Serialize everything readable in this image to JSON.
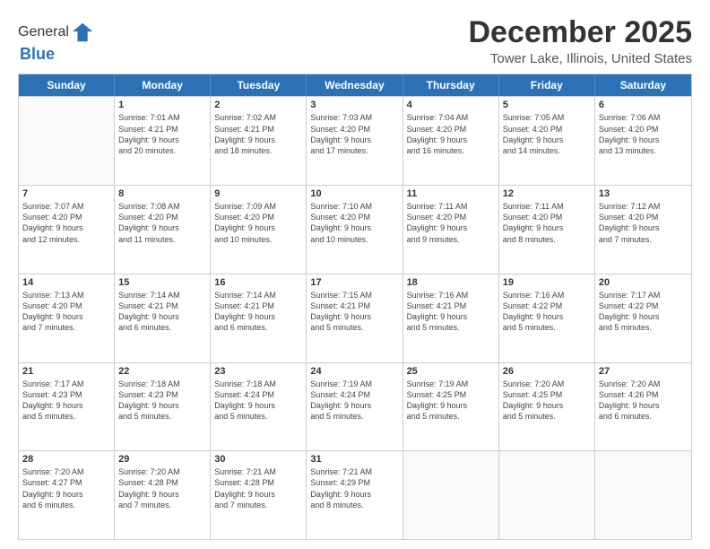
{
  "header": {
    "logo_line1": "General",
    "logo_line2": "Blue",
    "title": "December 2025",
    "subtitle": "Tower Lake, Illinois, United States"
  },
  "weekdays": [
    "Sunday",
    "Monday",
    "Tuesday",
    "Wednesday",
    "Thursday",
    "Friday",
    "Saturday"
  ],
  "weeks": [
    [
      {
        "day": "",
        "lines": []
      },
      {
        "day": "1",
        "lines": [
          "Sunrise: 7:01 AM",
          "Sunset: 4:21 PM",
          "Daylight: 9 hours",
          "and 20 minutes."
        ]
      },
      {
        "day": "2",
        "lines": [
          "Sunrise: 7:02 AM",
          "Sunset: 4:21 PM",
          "Daylight: 9 hours",
          "and 18 minutes."
        ]
      },
      {
        "day": "3",
        "lines": [
          "Sunrise: 7:03 AM",
          "Sunset: 4:20 PM",
          "Daylight: 9 hours",
          "and 17 minutes."
        ]
      },
      {
        "day": "4",
        "lines": [
          "Sunrise: 7:04 AM",
          "Sunset: 4:20 PM",
          "Daylight: 9 hours",
          "and 16 minutes."
        ]
      },
      {
        "day": "5",
        "lines": [
          "Sunrise: 7:05 AM",
          "Sunset: 4:20 PM",
          "Daylight: 9 hours",
          "and 14 minutes."
        ]
      },
      {
        "day": "6",
        "lines": [
          "Sunrise: 7:06 AM",
          "Sunset: 4:20 PM",
          "Daylight: 9 hours",
          "and 13 minutes."
        ]
      }
    ],
    [
      {
        "day": "7",
        "lines": [
          "Sunrise: 7:07 AM",
          "Sunset: 4:20 PM",
          "Daylight: 9 hours",
          "and 12 minutes."
        ]
      },
      {
        "day": "8",
        "lines": [
          "Sunrise: 7:08 AM",
          "Sunset: 4:20 PM",
          "Daylight: 9 hours",
          "and 11 minutes."
        ]
      },
      {
        "day": "9",
        "lines": [
          "Sunrise: 7:09 AM",
          "Sunset: 4:20 PM",
          "Daylight: 9 hours",
          "and 10 minutes."
        ]
      },
      {
        "day": "10",
        "lines": [
          "Sunrise: 7:10 AM",
          "Sunset: 4:20 PM",
          "Daylight: 9 hours",
          "and 10 minutes."
        ]
      },
      {
        "day": "11",
        "lines": [
          "Sunrise: 7:11 AM",
          "Sunset: 4:20 PM",
          "Daylight: 9 hours",
          "and 9 minutes."
        ]
      },
      {
        "day": "12",
        "lines": [
          "Sunrise: 7:11 AM",
          "Sunset: 4:20 PM",
          "Daylight: 9 hours",
          "and 8 minutes."
        ]
      },
      {
        "day": "13",
        "lines": [
          "Sunrise: 7:12 AM",
          "Sunset: 4:20 PM",
          "Daylight: 9 hours",
          "and 7 minutes."
        ]
      }
    ],
    [
      {
        "day": "14",
        "lines": [
          "Sunrise: 7:13 AM",
          "Sunset: 4:20 PM",
          "Daylight: 9 hours",
          "and 7 minutes."
        ]
      },
      {
        "day": "15",
        "lines": [
          "Sunrise: 7:14 AM",
          "Sunset: 4:21 PM",
          "Daylight: 9 hours",
          "and 6 minutes."
        ]
      },
      {
        "day": "16",
        "lines": [
          "Sunrise: 7:14 AM",
          "Sunset: 4:21 PM",
          "Daylight: 9 hours",
          "and 6 minutes."
        ]
      },
      {
        "day": "17",
        "lines": [
          "Sunrise: 7:15 AM",
          "Sunset: 4:21 PM",
          "Daylight: 9 hours",
          "and 5 minutes."
        ]
      },
      {
        "day": "18",
        "lines": [
          "Sunrise: 7:16 AM",
          "Sunset: 4:21 PM",
          "Daylight: 9 hours",
          "and 5 minutes."
        ]
      },
      {
        "day": "19",
        "lines": [
          "Sunrise: 7:16 AM",
          "Sunset: 4:22 PM",
          "Daylight: 9 hours",
          "and 5 minutes."
        ]
      },
      {
        "day": "20",
        "lines": [
          "Sunrise: 7:17 AM",
          "Sunset: 4:22 PM",
          "Daylight: 9 hours",
          "and 5 minutes."
        ]
      }
    ],
    [
      {
        "day": "21",
        "lines": [
          "Sunrise: 7:17 AM",
          "Sunset: 4:23 PM",
          "Daylight: 9 hours",
          "and 5 minutes."
        ]
      },
      {
        "day": "22",
        "lines": [
          "Sunrise: 7:18 AM",
          "Sunset: 4:23 PM",
          "Daylight: 9 hours",
          "and 5 minutes."
        ]
      },
      {
        "day": "23",
        "lines": [
          "Sunrise: 7:18 AM",
          "Sunset: 4:24 PM",
          "Daylight: 9 hours",
          "and 5 minutes."
        ]
      },
      {
        "day": "24",
        "lines": [
          "Sunrise: 7:19 AM",
          "Sunset: 4:24 PM",
          "Daylight: 9 hours",
          "and 5 minutes."
        ]
      },
      {
        "day": "25",
        "lines": [
          "Sunrise: 7:19 AM",
          "Sunset: 4:25 PM",
          "Daylight: 9 hours",
          "and 5 minutes."
        ]
      },
      {
        "day": "26",
        "lines": [
          "Sunrise: 7:20 AM",
          "Sunset: 4:25 PM",
          "Daylight: 9 hours",
          "and 5 minutes."
        ]
      },
      {
        "day": "27",
        "lines": [
          "Sunrise: 7:20 AM",
          "Sunset: 4:26 PM",
          "Daylight: 9 hours",
          "and 6 minutes."
        ]
      }
    ],
    [
      {
        "day": "28",
        "lines": [
          "Sunrise: 7:20 AM",
          "Sunset: 4:27 PM",
          "Daylight: 9 hours",
          "and 6 minutes."
        ]
      },
      {
        "day": "29",
        "lines": [
          "Sunrise: 7:20 AM",
          "Sunset: 4:28 PM",
          "Daylight: 9 hours",
          "and 7 minutes."
        ]
      },
      {
        "day": "30",
        "lines": [
          "Sunrise: 7:21 AM",
          "Sunset: 4:28 PM",
          "Daylight: 9 hours",
          "and 7 minutes."
        ]
      },
      {
        "day": "31",
        "lines": [
          "Sunrise: 7:21 AM",
          "Sunset: 4:29 PM",
          "Daylight: 9 hours",
          "and 8 minutes."
        ]
      },
      {
        "day": "",
        "lines": []
      },
      {
        "day": "",
        "lines": []
      },
      {
        "day": "",
        "lines": []
      }
    ]
  ]
}
